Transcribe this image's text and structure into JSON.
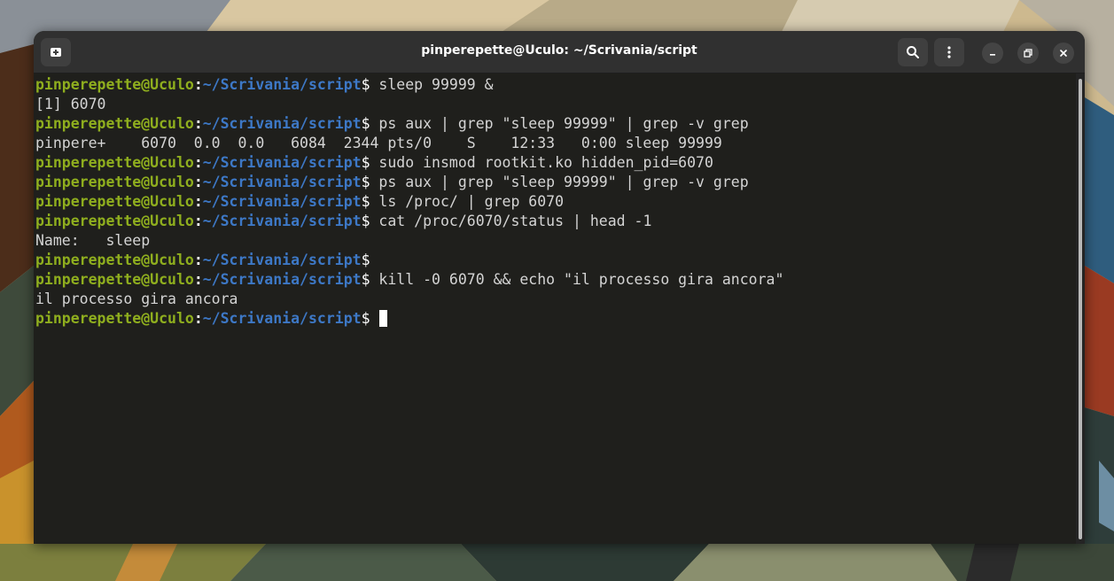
{
  "window": {
    "title": "pinperepette@Uculo: ~/Scrivania/script"
  },
  "headerbar": {
    "new_tab_icon": "new-tab-icon",
    "search_icon": "search-icon",
    "menu_icon": "vertical-dots-icon",
    "minimize_icon": "minimize-icon",
    "maximize_icon": "maximize-icon",
    "close_icon": "close-icon"
  },
  "prompt": {
    "user": "pinperepette@Uculo",
    "colon": ":",
    "path": "~/Scrivania/script",
    "symbol": "$"
  },
  "lines": [
    {
      "type": "prompt",
      "cmd": " sleep 99999 &"
    },
    {
      "type": "output",
      "text": "[1] 6070"
    },
    {
      "type": "prompt",
      "cmd": " ps aux | grep \"sleep 99999\" | grep -v grep"
    },
    {
      "type": "output",
      "text": "pinpere+    6070  0.0  0.0   6084  2344 pts/0    S    12:33   0:00 sleep 99999"
    },
    {
      "type": "prompt",
      "cmd": " sudo insmod rootkit.ko hidden_pid=6070"
    },
    {
      "type": "prompt",
      "cmd": " ps aux | grep \"sleep 99999\" | grep -v grep"
    },
    {
      "type": "prompt",
      "cmd": " ls /proc/ | grep 6070"
    },
    {
      "type": "prompt",
      "cmd": " cat /proc/6070/status | head -1"
    },
    {
      "type": "output",
      "text": "Name:   sleep"
    },
    {
      "type": "prompt",
      "cmd": ""
    },
    {
      "type": "prompt",
      "cmd": " kill -0 6070 && echo \"il processo gira ancora\""
    },
    {
      "type": "output",
      "text": "il processo gira ancora"
    },
    {
      "type": "prompt",
      "cmd": "",
      "cursor": true
    }
  ],
  "colors": {
    "prompt_user": "#8fae1e",
    "prompt_path": "#3d78c6",
    "terminal_bg": "#1f1f1c",
    "text": "#d4d4d4"
  }
}
